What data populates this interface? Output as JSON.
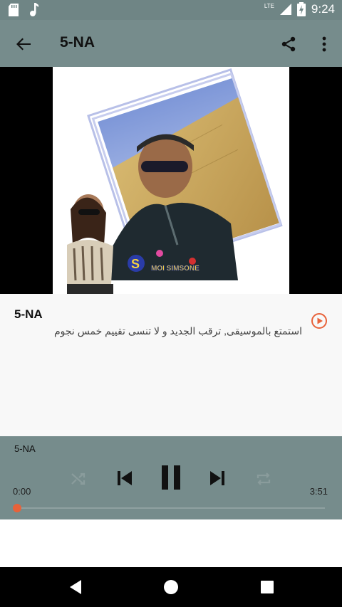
{
  "status_bar": {
    "icons": [
      "sd-card-icon",
      "music-note-icon",
      "lte-signal-icon",
      "battery-charging-icon"
    ],
    "network_label": "LTE",
    "time": "9:24"
  },
  "app_bar": {
    "title": "5-NA",
    "icons": [
      "back-arrow-icon",
      "share-icon",
      "more-vert-icon"
    ]
  },
  "album_art": {
    "caption_left": "S",
    "caption_right": "MOI SIMSONE"
  },
  "track": {
    "title": "5-NA",
    "description": "استمتع بالموسيقى, ترقب الجديد و لا تنسى تقييم خمس نجوم"
  },
  "player": {
    "title": "5-NA",
    "elapsed": "0:00",
    "duration": "3:51",
    "progress_fraction": 0.0,
    "accent_color": "#e8623a",
    "controls": [
      "shuffle-icon",
      "skip-previous-icon",
      "pause-icon",
      "skip-next-icon",
      "repeat-icon"
    ]
  },
  "nav_bar": {
    "buttons": [
      "back-triangle-icon",
      "home-circle-icon",
      "recents-square-icon"
    ]
  },
  "colors": {
    "toolbar": "#768c8c",
    "status_bar": "#6f8585",
    "accent": "#e8623a"
  }
}
